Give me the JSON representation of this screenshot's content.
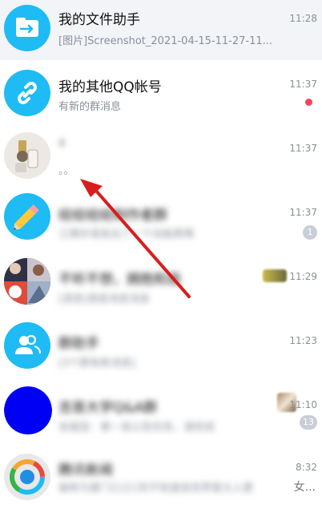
{
  "colors": {
    "accent_blue": "#1ebbf4",
    "pinned_bg": "#f2f4f7",
    "unread_red": "#f5455c",
    "arrow_red": "#d81e1e",
    "circle_blue": "#0000f5"
  },
  "chats": [
    {
      "title": "我的文件助手",
      "subtitle": "[图片]Screenshot_2021-04-15-11-27-11...",
      "time": "11:28",
      "avatar_icon": "file-transfer-icon"
    },
    {
      "title": "我的其他QQ帐号",
      "subtitle": "有新的群消息",
      "time": "11:37",
      "avatar_icon": "link-icon"
    },
    {
      "title": "4",
      "subtitle": "。。",
      "time": "11:37",
      "avatar_icon": "photo-avatar"
    },
    {
      "title": "绘绘绘绘制作者群",
      "subtitle": "江莱妙语发出了一个动画表情",
      "time": "11:37",
      "badge": "1",
      "avatar_icon": "pencil-icon"
    },
    {
      "title": "不听不想，拥抱和我",
      "subtitle": "[语音]语音消息消息",
      "time": "11:29",
      "avatar_icon": "group-photo-avatar"
    },
    {
      "title": "群助手",
      "subtitle": "[3个群有新消息]",
      "time": "11:23",
      "avatar_icon": "group-assistant-icon"
    },
    {
      "title": "吉首大学Q&A群",
      "subtitle": "张福宝：第一发公告任务，请完成",
      "time": "11:10",
      "badge": "13",
      "avatar_icon": "blue-circle-avatar"
    },
    {
      "title": "腾讯新闻",
      "subtitle": "被称为第门口之C的不知道说世界是大人更",
      "time": "8:32",
      "trailing": "女...",
      "avatar_icon": "tencent-news-icon"
    }
  ]
}
